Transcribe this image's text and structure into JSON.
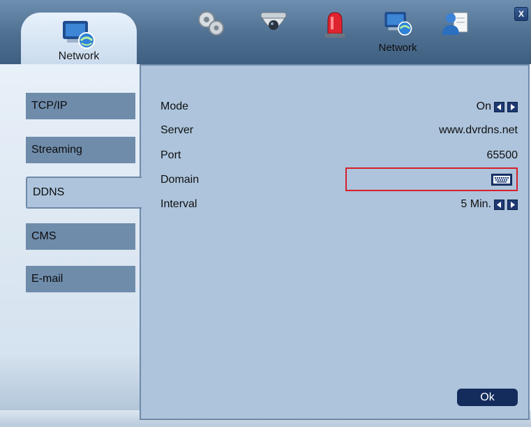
{
  "header": {
    "active_tab_label": "Network",
    "hover_label": "Network",
    "close_label": "X",
    "icons": [
      "network-icon",
      "gear-icon",
      "camera-icon",
      "alarm-icon",
      "network-icon",
      "user-icon"
    ]
  },
  "sidebar": {
    "items": [
      {
        "label": "TCP/IP"
      },
      {
        "label": "Streaming"
      },
      {
        "label": "DDNS",
        "active": true
      },
      {
        "label": "CMS"
      },
      {
        "label": "E-mail"
      }
    ]
  },
  "ddns": {
    "mode": {
      "label": "Mode",
      "value": "On"
    },
    "server": {
      "label": "Server",
      "value": "www.dvrdns.net"
    },
    "port": {
      "label": "Port",
      "value": "65500"
    },
    "domain": {
      "label": "Domain",
      "value": ""
    },
    "interval": {
      "label": "Interval",
      "value": "5 Min."
    }
  },
  "footer": {
    "ok_label": "Ok"
  },
  "colors": {
    "panel": "#adc4dc",
    "accent": "#1e3a73",
    "highlight": "#d81e2a"
  }
}
